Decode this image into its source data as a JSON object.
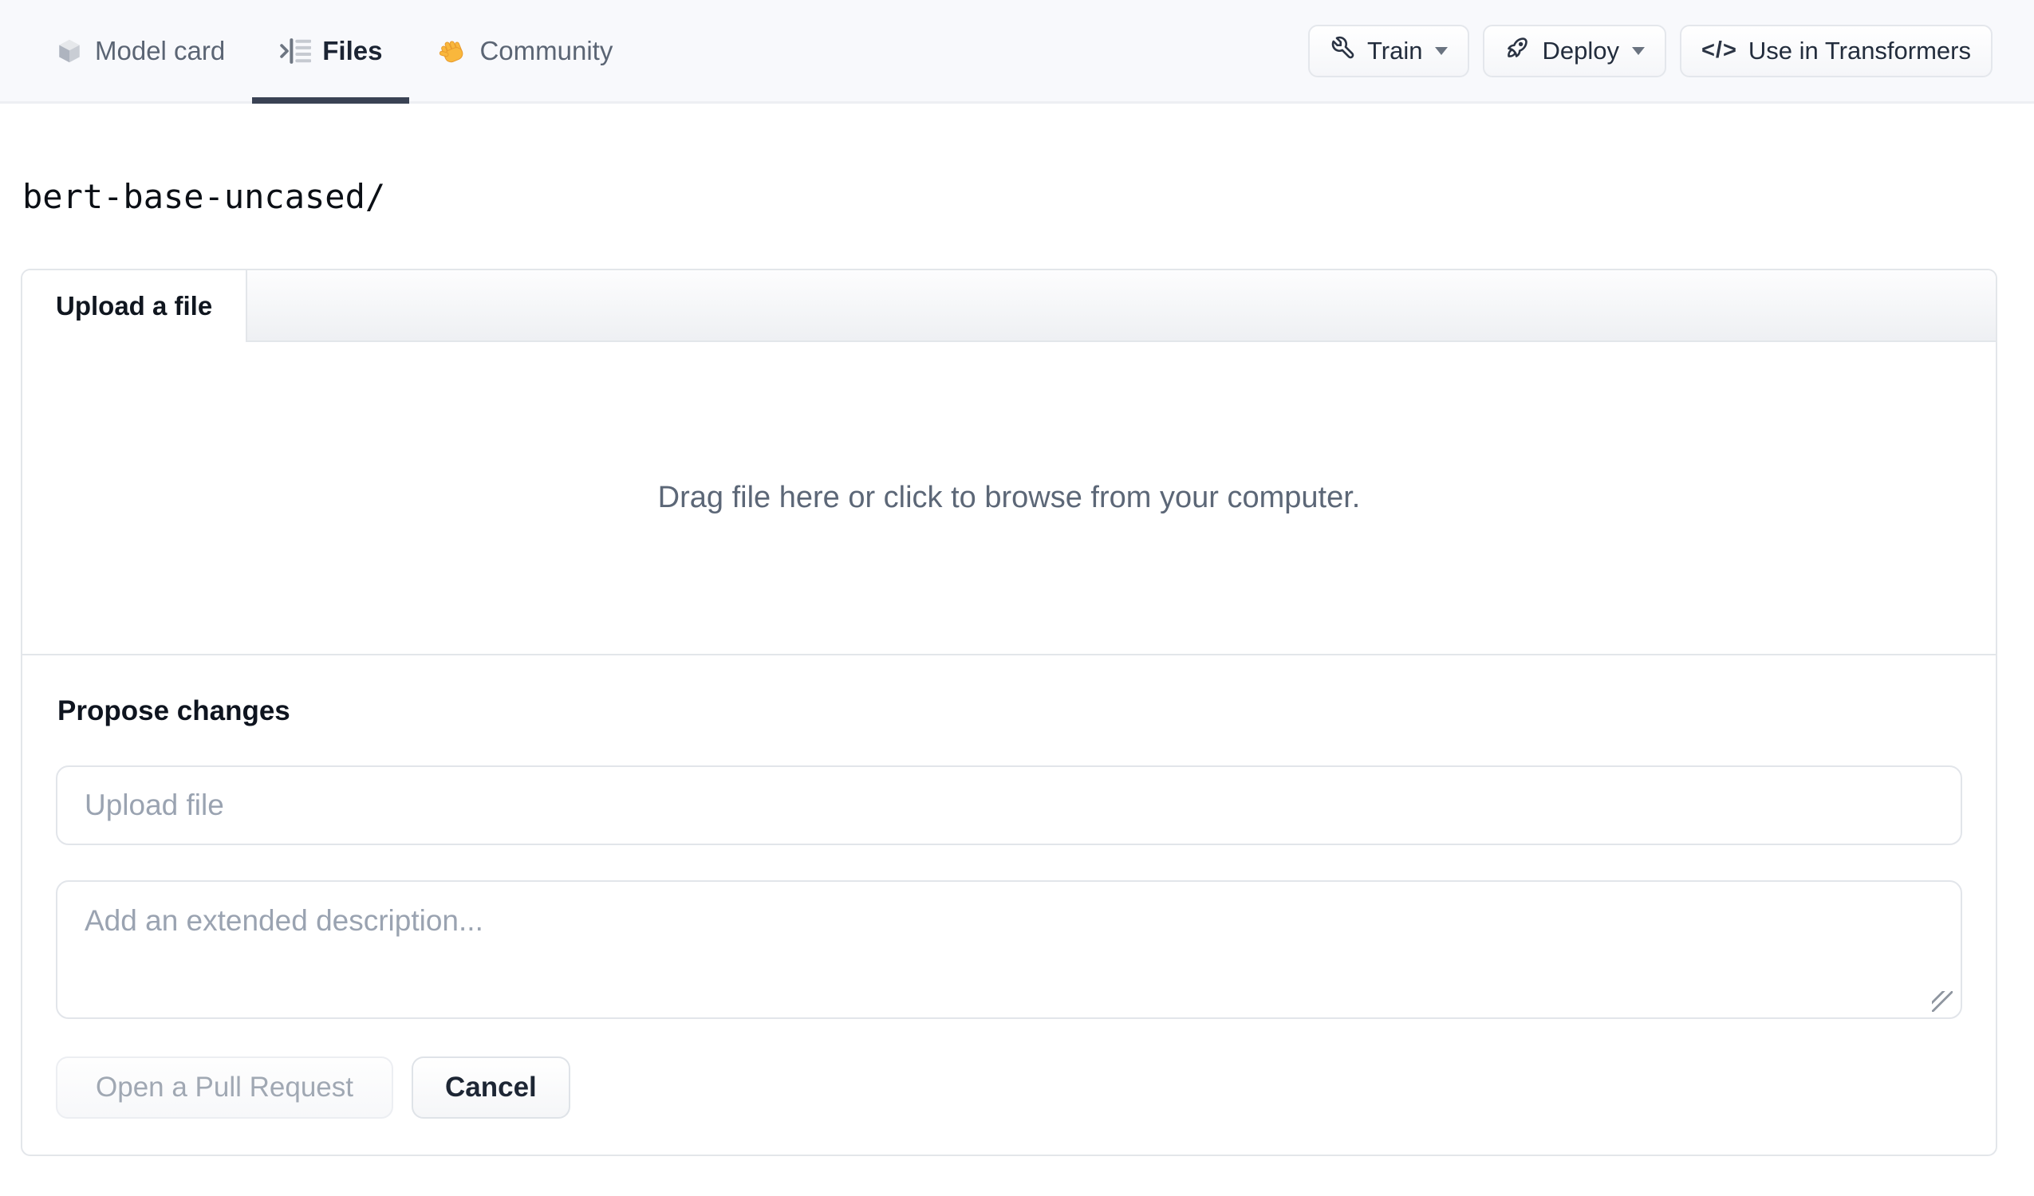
{
  "nav": {
    "tabs": [
      {
        "label": "Model card",
        "icon": "cube-icon",
        "active": false
      },
      {
        "label": "Files",
        "icon": "files-list-icon",
        "active": true
      },
      {
        "label": "Community",
        "icon": "waving-hand-icon",
        "active": false
      }
    ],
    "actions": [
      {
        "label": "Train",
        "icon": "wrench-icon",
        "has_caret": true
      },
      {
        "label": "Deploy",
        "icon": "rocket-icon",
        "has_caret": true
      },
      {
        "label": "Use in Transformers",
        "icon": "code-icon",
        "has_caret": false
      }
    ],
    "code_glyph": "</>"
  },
  "repo": {
    "path": "bert-base-uncased/"
  },
  "upload_card": {
    "tab_label": "Upload a file",
    "dropzone_text": "Drag file here or click to browse from your computer.",
    "propose_heading": "Propose changes",
    "file_input_placeholder": "Upload file",
    "description_placeholder": "Add an extended description...",
    "submit_label": "Open a Pull Request",
    "cancel_label": "Cancel"
  },
  "colors": {
    "nav_bg": "#f8f9fc",
    "nav_border": "#edeff3",
    "border": "#e3e6ea",
    "underline": "#3a4254",
    "text_primary": "#1b2433",
    "text_secondary": "#5b6574",
    "placeholder": "#9aa3b1",
    "disabled_text": "#a0a8b3",
    "hand_yellow": "#f9b73c"
  }
}
